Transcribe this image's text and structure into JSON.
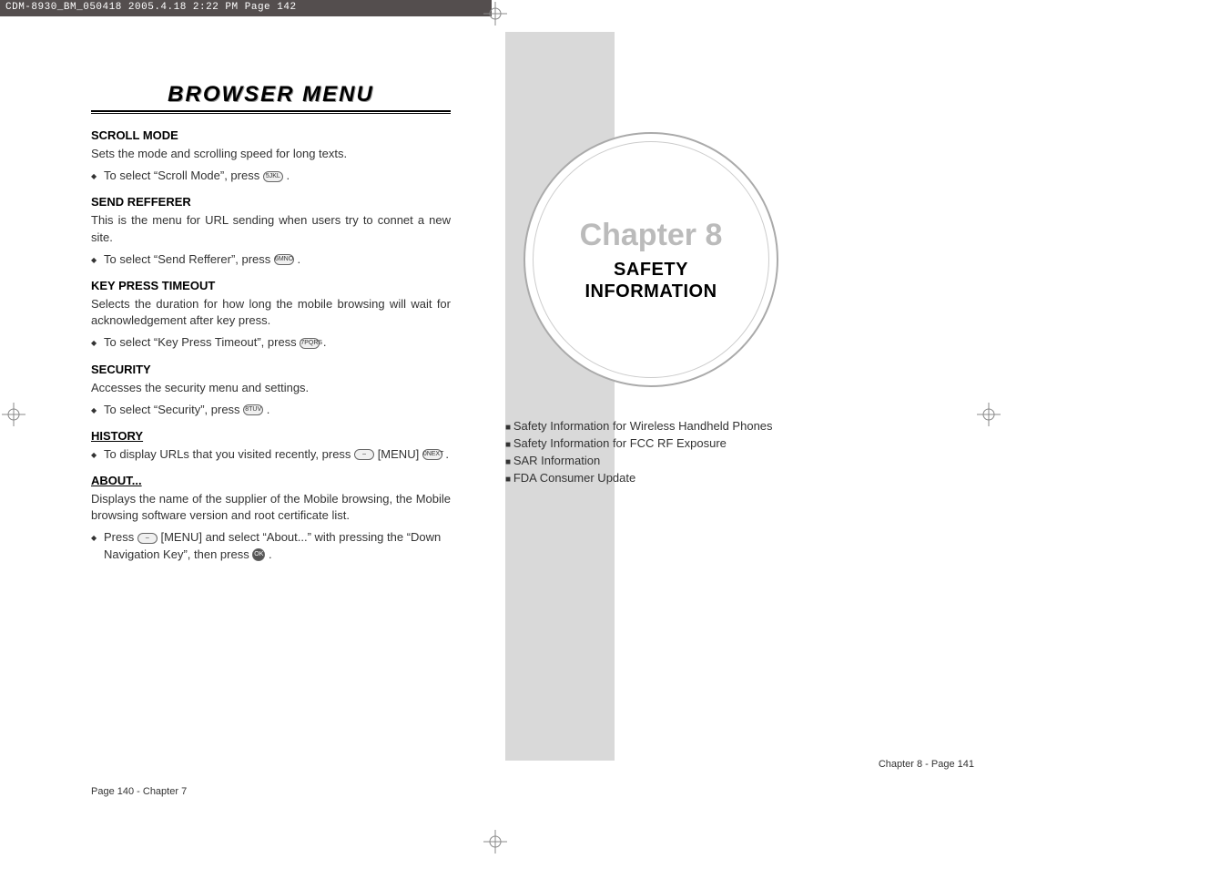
{
  "header": {
    "text": "CDM-8930_BM_050418  2005.4.18  2:22 PM  Page 142"
  },
  "leftPage": {
    "title": "BROWSER MENU",
    "sections": {
      "scrollMode": {
        "heading": "SCROLL MODE",
        "desc": "Sets the mode and scrolling speed for long texts.",
        "bullet": "To select “Scroll Mode”, press",
        "key": "5JKL"
      },
      "sendRefferer": {
        "heading": "SEND REFFERER",
        "desc": "This is the menu for URL sending when users try to connet a new site.",
        "bullet": "To select “Send Refferer”, press",
        "key": "6MNO"
      },
      "keyPressTimeout": {
        "heading": "KEY PRESS TIMEOUT",
        "desc": "Selects the duration for how long the mobile browsing will wait for acknowledgement after key press.",
        "bullet": "To select “Key Press Timeout”, press",
        "key": "7PQRS"
      },
      "security": {
        "heading": "SECURITY",
        "desc": "Accesses the security menu and settings.",
        "bullet": "To select “Security”, press",
        "key": "8TUV"
      },
      "history": {
        "heading": "HISTORY",
        "bulletPrefix": "To display URLs that you visited recently, press",
        "menuLabel": "[MENU]",
        "softKey": "–",
        "key": "0NEXT"
      },
      "about": {
        "heading": "ABOUT...",
        "desc": "Displays the name of the supplier of the Mobile browsing, the Mobile browsing software version and root certificate list.",
        "bulletPrefix": "Press",
        "menuLabel": "[MENU] and select “About...” with pressing the “Down Navigation Key”, then press",
        "softKey": "–",
        "okKey": "OK"
      }
    },
    "footer": "Page 140 - Chapter 7"
  },
  "rightPage": {
    "chapterLabel": "Chapter 8",
    "chapterTitle1": "SAFETY",
    "chapterTitle2": "INFORMATION",
    "toc": [
      "Safety Information for Wireless Handheld Phones",
      "Safety Information for FCC RF Exposure",
      "SAR Information",
      "FDA Consumer Update"
    ],
    "footer": "Chapter 8 - Page 141"
  }
}
